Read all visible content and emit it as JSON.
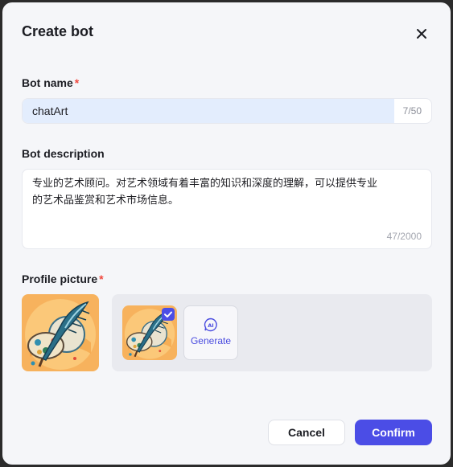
{
  "dialog": {
    "title": "Create bot",
    "close_icon": "close-icon"
  },
  "bot_name": {
    "label": "Bot name",
    "required_mark": "*",
    "value": "chatArt",
    "counter": "7/50"
  },
  "bot_description": {
    "label": "Bot description",
    "value": "专业的艺术顾问。对艺术领域有着丰富的知识和深度的理解，可以提供专业的艺术品鉴赏和艺术市场信息。",
    "counter": "47/2000"
  },
  "profile_picture": {
    "label": "Profile picture",
    "required_mark": "*",
    "selected_icon": "check-icon",
    "generate_icon": "ai-sparkle-icon",
    "generate_label": "Generate",
    "image": "feather-and-palette-art-avatar"
  },
  "footer": {
    "cancel_label": "Cancel",
    "confirm_label": "Confirm"
  },
  "colors": {
    "accent": "#4b4de6",
    "required": "#f0483e",
    "input_highlight": "#e3edfd",
    "background": "#f5f6f9"
  }
}
